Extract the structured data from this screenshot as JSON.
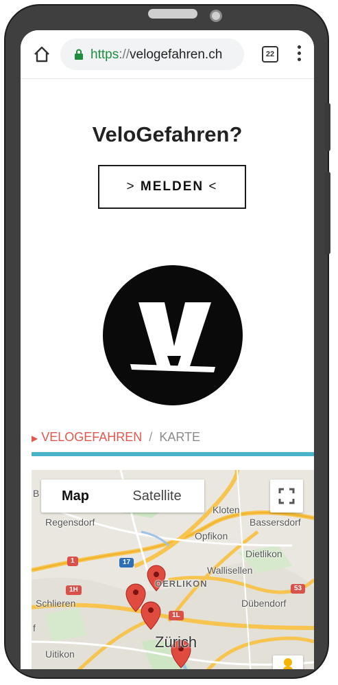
{
  "browser": {
    "url_protocol": "https",
    "url_separator": "://",
    "url_host": "velogefahren.ch",
    "tab_count": "22"
  },
  "page": {
    "title": "VeloGefahren?",
    "melden_arrow_left": ">",
    "melden_label": "MELDEN",
    "melden_arrow_right": "<"
  },
  "breadcrumb": {
    "marker": "▶",
    "active": "VELOGEFAHREN",
    "separator": "/",
    "inactive": "KARTE"
  },
  "map": {
    "type_map": "Map",
    "type_satellite": "Satellite",
    "places": {
      "kloten": "Kloten",
      "regensdorf": "Regensdorf",
      "bassersdorf": "Bassersdorf",
      "opfikon": "Opfikon",
      "dietlikon": "Dietlikon",
      "wallisellen": "Wallisellen",
      "oerlikon": "OERLIKON",
      "schlieren": "Schlieren",
      "dubendorf": "Dübendorf",
      "zurich": "Zürich",
      "uitikon": "Uitikon",
      "edge_b": "B",
      "edge_f": "f"
    },
    "shields": [
      "1",
      "17",
      "1H",
      "1L",
      "53",
      "1"
    ]
  },
  "colors": {
    "accent_red": "#e2574c",
    "divider_teal": "#4bb3c8",
    "lock_green": "#1e8e3e",
    "marker_red": "#e04b3f"
  },
  "icons": [
    "home-icon",
    "lock-icon",
    "tabs-icon",
    "more-vert-icon",
    "velo-logo",
    "fullscreen-icon",
    "map-marker-icon",
    "pegman-icon"
  ]
}
